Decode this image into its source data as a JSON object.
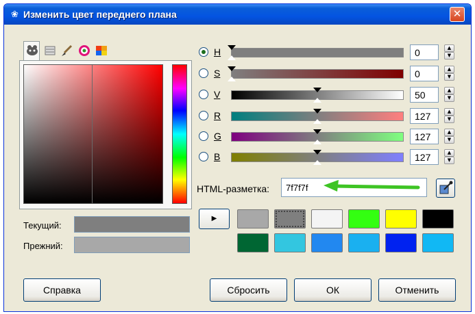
{
  "window": {
    "title": "Изменить цвет переднего плана",
    "close_glyph": "✕",
    "app_icon": "gimp-icon"
  },
  "tabs": [
    {
      "icon": "gimp-selector-icon",
      "active": true
    },
    {
      "icon": "scales-icon",
      "active": false
    },
    {
      "icon": "brush-icon",
      "active": false
    },
    {
      "icon": "color-wheel-icon",
      "active": false
    },
    {
      "icon": "palette-icon",
      "active": false
    }
  ],
  "swatches": {
    "current_label": "Текущий:",
    "current_color": "#7f7f7f",
    "previous_label": "Прежний:",
    "previous_color": "#a8a8a8"
  },
  "channels": [
    {
      "label": "H",
      "value": "0",
      "level": 0,
      "checked": true,
      "gradient": "linear-gradient(to right, #7f7f7f, #7f7f7f)"
    },
    {
      "label": "S",
      "value": "0",
      "level": 0,
      "checked": false,
      "gradient": "linear-gradient(to right, #7f7f7f, #7f0000)"
    },
    {
      "label": "V",
      "value": "50",
      "level": 0.5,
      "checked": false,
      "gradient": "linear-gradient(to right, #000000, #ffffff)"
    },
    {
      "label": "R",
      "value": "127",
      "level": 0.498,
      "checked": false,
      "gradient": "linear-gradient(to right, #007f7f, #ff7f7f)"
    },
    {
      "label": "G",
      "value": "127",
      "level": 0.498,
      "checked": false,
      "gradient": "linear-gradient(to right, #7f007f, #7fff7f)"
    },
    {
      "label": "B",
      "value": "127",
      "level": 0.498,
      "checked": false,
      "gradient": "linear-gradient(to right, #7f7f00, #7f7fff)"
    }
  ],
  "html": {
    "label": "HTML-разметка:",
    "value": "7f7f7f",
    "eyedropper_icon": "eyedropper-icon"
  },
  "history": {
    "arrow": "▶",
    "colors": [
      "#a8a8a8",
      "#7f7f7f",
      "#f4f4f4",
      "#33ff11",
      "#ffff00",
      "#000000",
      "#006633",
      "#33c6e0",
      "#2288f0",
      "#1ab0f0",
      "#0022f0",
      "#11b8f4"
    ],
    "selected_index": 1
  },
  "buttons": {
    "help": "Справка",
    "reset": "Сбросить",
    "ok": "ОК",
    "cancel": "Отменить"
  },
  "annotation": {
    "arrow_color": "#3ec424"
  }
}
